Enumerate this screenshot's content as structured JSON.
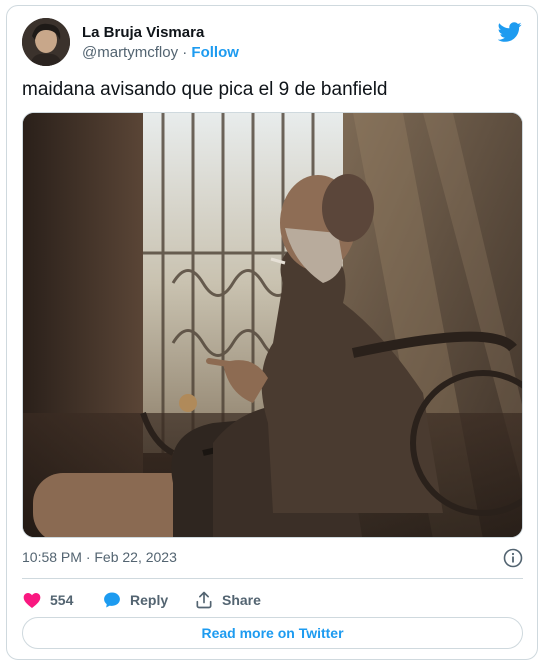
{
  "author": {
    "name": "La Bruja Vismara",
    "handle": "@martymcfloy",
    "separator": "·",
    "follow_label": "Follow"
  },
  "tweet": {
    "text": "maidana avisando que pica el 9 de banfield",
    "timestamp": "10:58 PM · Feb 22, 2023"
  },
  "actions": {
    "like_count": "554",
    "reply_label": "Reply",
    "share_label": "Share"
  },
  "read_more_label": "Read more on Twitter",
  "colors": {
    "accent": "#1d9bf0",
    "like": "#f91880",
    "secondary_text": "#536471",
    "border": "#cfd9de"
  },
  "icons": [
    "twitter-bird-icon",
    "info-icon",
    "heart-icon",
    "reply-bubble-icon",
    "share-icon"
  ]
}
